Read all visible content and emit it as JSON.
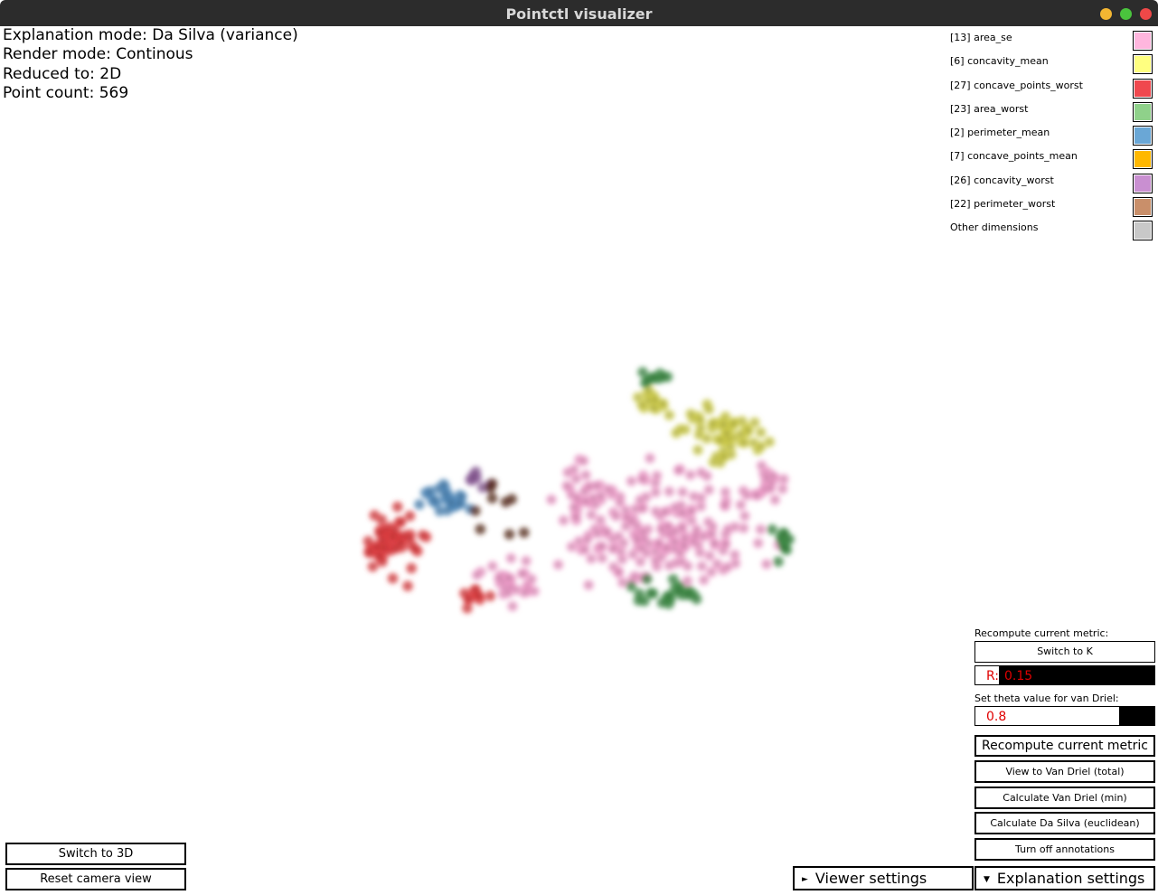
{
  "window": {
    "title": "Pointctl visualizer"
  },
  "info": {
    "explanation_mode": "Explanation mode: Da Silva (variance)",
    "render_mode": "Render mode: Continous",
    "reduced_to": "Reduced to: 2D",
    "point_count": "Point count: 569"
  },
  "legend": {
    "items": [
      {
        "label": "[13] area_se",
        "color": "#ffb6de"
      },
      {
        "label": "[6] concavity_mean",
        "color": "#ffff80"
      },
      {
        "label": "[27] concave_points_worst",
        "color": "#f0484e"
      },
      {
        "label": "[23] area_worst",
        "color": "#8fd18a"
      },
      {
        "label": "[2] perimeter_mean",
        "color": "#6aa7d6"
      },
      {
        "label": "[7] concave_points_mean",
        "color": "#ffb800"
      },
      {
        "label": "[26] concavity_worst",
        "color": "#c98fd1"
      },
      {
        "label": "[22] perimeter_worst",
        "color": "#c98f6a"
      },
      {
        "label": "Other dimensions",
        "color": "#c8c8c8"
      }
    ]
  },
  "controls": {
    "recompute_label": "Recompute current metric:",
    "switch_to_k": "Switch to K",
    "r_label": "R:",
    "r_value": "0.15",
    "theta_label": "Set theta value for van Driel:",
    "theta_value": "0.8",
    "recompute_button": "Recompute current metric",
    "view_van_driel_total": "View to Van Driel (total)",
    "calc_van_driel_min": "Calculate Van Driel (min)",
    "calc_da_silva_euclidean": "Calculate Da Silva (euclidean)",
    "turn_off_annotations": "Turn off annotations",
    "viewer_settings": "Viewer settings",
    "explanation_settings": "Explanation settings",
    "switch_to_3d": "Switch to 3D",
    "reset_camera": "Reset camera view"
  },
  "scatter": {
    "cluster_colors": {
      "pink": "#e99ac6",
      "yellow": "#c9c84a",
      "red": "#d93b3f",
      "green": "#3e8a45",
      "blue": "#4d86b5",
      "purple": "#8a5b96",
      "brown": "#5a2c1e"
    }
  }
}
